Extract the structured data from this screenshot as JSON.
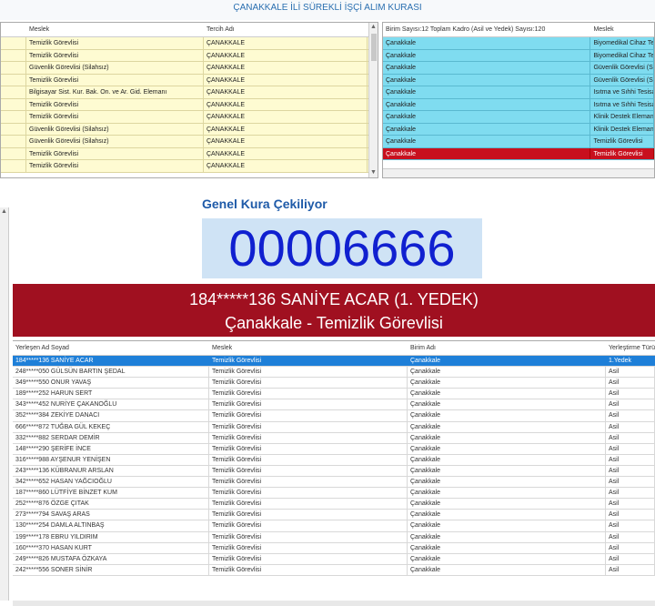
{
  "title": "ÇANAKKALE İLİ SÜREKLİ İŞÇİ ALIM KURASI",
  "top_left": {
    "columns": [
      "",
      "Meslek",
      "Tercih Adı"
    ],
    "rows": [
      [
        "",
        "Temizlik Görevlisi",
        "ÇANAKKALE"
      ],
      [
        "",
        "Temizlik Görevlisi",
        "ÇANAKKALE"
      ],
      [
        "",
        "Güvenlik Görevlisi (Silahsız)",
        "ÇANAKKALE"
      ],
      [
        "",
        "Temizlik Görevlisi",
        "ÇANAKKALE"
      ],
      [
        "",
        "Bilgisayar Sist. Kur. Bak. On. ve Ar. Gid. Elemanı",
        "ÇANAKKALE"
      ],
      [
        "",
        "Temizlik Görevlisi",
        "ÇANAKKALE"
      ],
      [
        "",
        "Temizlik Görevlisi",
        "ÇANAKKALE"
      ],
      [
        "",
        "Güvenlik Görevlisi (Silahsız)",
        "ÇANAKKALE"
      ],
      [
        "",
        "Güvenlik Görevlisi (Silahsız)",
        "ÇANAKKALE"
      ],
      [
        "",
        "Temizlik Görevlisi",
        "ÇANAKKALE"
      ],
      [
        "",
        "Temizlik Görevlisi",
        "ÇANAKKALE"
      ]
    ]
  },
  "top_right": {
    "columns": [
      "Birim Sayısı:12 Toplam Kadro (Asil ve Yedek) Sayısı:120",
      "Meslek"
    ],
    "rows": [
      [
        "Çanakkale",
        "Biyomedikal Cihaz Tekn"
      ],
      [
        "Çanakkale",
        "Biyomedikal Cihaz Tekn"
      ],
      [
        "Çanakkale",
        "Güvenlik Görevlisi (Sila"
      ],
      [
        "Çanakkale",
        "Güvenlik Görevlisi (Sila"
      ],
      [
        "Çanakkale",
        "Isıtma ve Sıhhi Tesisatç"
      ],
      [
        "Çanakkale",
        "Isıtma ve Sıhhi Tesisatç"
      ],
      [
        "Çanakkale",
        "Klinik Destek Elemanı (I"
      ],
      [
        "Çanakkale",
        "Klinik Destek Elemanı (I"
      ],
      [
        "Çanakkale",
        "Temizlik Görevlisi"
      ],
      [
        "Çanakkale",
        "Temizlik Görevlisi"
      ]
    ]
  },
  "draw": {
    "label": "Genel Kura Çekiliyor",
    "number": "00006666",
    "winner_line1": "184*****136 SANİYE ACAR (1. YEDEK)",
    "winner_line2": "Çanakkale - Temizlik Görevlisi"
  },
  "results": {
    "columns": [
      "Yerleşen Ad Soyad",
      "Meslek",
      "Birim Adı",
      "Yerleştirme Türü"
    ],
    "rows": [
      [
        "184*****136 SANİYE ACAR",
        "Temizlik Görevlisi",
        "Çanakkale",
        "1.Yedek"
      ],
      [
        "248*****050 GÜLSÜN BARTIN ŞEDAL",
        "Temizlik Görevlisi",
        "Çanakkale",
        "Asil"
      ],
      [
        "349*****550 ONUR YAVAŞ",
        "Temizlik Görevlisi",
        "Çanakkale",
        "Asil"
      ],
      [
        "189*****252 HARUN SERT",
        "Temizlik Görevlisi",
        "Çanakkale",
        "Asil"
      ],
      [
        "343*****452 NURİYE ÇAKANOĞLU",
        "Temizlik Görevlisi",
        "Çanakkale",
        "Asil"
      ],
      [
        "352*****384 ZEKİYE DANACI",
        "Temizlik Görevlisi",
        "Çanakkale",
        "Asil"
      ],
      [
        "666*****872 TUĞBA GÜL KEKEÇ",
        "Temizlik Görevlisi",
        "Çanakkale",
        "Asil"
      ],
      [
        "332*****882 SERDAR DEMİR",
        "Temizlik Görevlisi",
        "Çanakkale",
        "Asil"
      ],
      [
        "148*****290 ŞERİFE İNCE",
        "Temizlik Görevlisi",
        "Çanakkale",
        "Asil"
      ],
      [
        "316*****988 AYŞENUR YENİŞEN",
        "Temizlik Görevlisi",
        "Çanakkale",
        "Asil"
      ],
      [
        "243*****136 KÜBRANUR ARSLAN",
        "Temizlik Görevlisi",
        "Çanakkale",
        "Asil"
      ],
      [
        "342*****652 HASAN YAĞCIOĞLU",
        "Temizlik Görevlisi",
        "Çanakkale",
        "Asil"
      ],
      [
        "187*****860 LÜTFİYE BİNZET KUM",
        "Temizlik Görevlisi",
        "Çanakkale",
        "Asil"
      ],
      [
        "252*****876 ÖZGE ÇITAK",
        "Temizlik Görevlisi",
        "Çanakkale",
        "Asil"
      ],
      [
        "273*****794 SAVAŞ ARAS",
        "Temizlik Görevlisi",
        "Çanakkale",
        "Asil"
      ],
      [
        "130*****254 DAMLA ALTINBAŞ",
        "Temizlik Görevlisi",
        "Çanakkale",
        "Asil"
      ],
      [
        "199*****178 EBRU YILDIRIM",
        "Temizlik Görevlisi",
        "Çanakkale",
        "Asil"
      ],
      [
        "160*****370 HASAN KURT",
        "Temizlik Görevlisi",
        "Çanakkale",
        "Asil"
      ],
      [
        "249*****826 MUSTAFA ÖZKAYA",
        "Temizlik Görevlisi",
        "Çanakkale",
        "Asil"
      ],
      [
        "242*****556 SONER SİNİR",
        "Temizlik Görevlisi",
        "Çanakkale",
        "Asil"
      ]
    ]
  },
  "colors": {
    "title": "#2a6fb0",
    "top_left_row": "#fefbd2",
    "top_right_row": "#7fdcf0",
    "highlight_row": "#c8101e",
    "banner": "#a01020",
    "number": "#1020d0",
    "selected_row": "#1e7fd8"
  }
}
